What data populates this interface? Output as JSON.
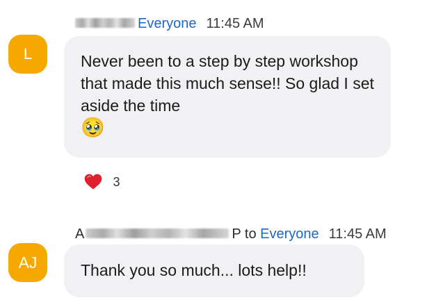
{
  "messages": [
    {
      "avatar_initials": "L",
      "avatar_color": "#f5a800",
      "sender_visible_tail": "",
      "recipient_prefix": "",
      "recipient": "Everyone",
      "time": "11:45 AM",
      "text": "Never been to a step by step workshop that made this much sense!! So glad I set aside the time",
      "emoji": "🥹",
      "reaction": {
        "emoji": "❤️",
        "icon": "heart-icon",
        "count": "3"
      }
    },
    {
      "avatar_initials": "AJ",
      "avatar_color": "#f5a800",
      "sender_visible_head": "A",
      "sender_visible_tail": "P",
      "recipient_prefix": "to",
      "recipient": "Everyone",
      "time": "11:45 AM",
      "text": "Thank you so much... lots help!!"
    }
  ],
  "colors": {
    "bubble": "#f1f1f4",
    "recipient_link": "#1c66c7",
    "heart": "#e0202c"
  }
}
